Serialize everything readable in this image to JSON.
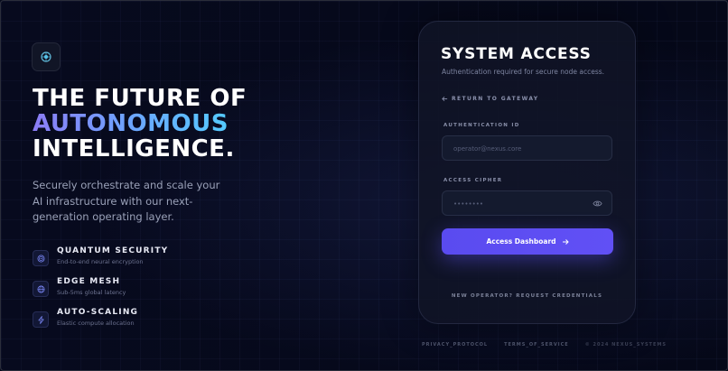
{
  "hero": {
    "line1": "THE FUTURE OF",
    "line2": "AUTONOMOUS",
    "line3": "INTELLIGENCE.",
    "description": "Securely orchestrate and scale your AI infrastructure with our next-generation operating layer."
  },
  "features": [
    {
      "title": "QUANTUM SECURITY",
      "subtitle": "End-to-end neural encryption",
      "icon": "fingerprint-icon"
    },
    {
      "title": "EDGE MESH",
      "subtitle": "Sub-5ms global latency",
      "icon": "globe-icon"
    },
    {
      "title": "AUTO-SCALING",
      "subtitle": "Elastic compute allocation",
      "icon": "lightning-icon"
    }
  ],
  "card": {
    "title": "SYSTEM ACCESS",
    "subtitle": "Authentication required for secure node access.",
    "back_label": "RETURN TO GATEWAY",
    "id_label": "AUTHENTICATION ID",
    "id_placeholder": "operator@nexus.core",
    "cipher_label": "ACCESS CIPHER",
    "cipher_placeholder": "••••••••",
    "submit_label": "Access Dashboard",
    "request_label": "NEW OPERATOR? REQUEST CREDENTIALS"
  },
  "footer": {
    "privacy": "PRIVACY_PROTOCOL",
    "terms": "TERMS_OF_SERVICE",
    "copyright": "© 2024 NEXUS_SYSTEMS"
  },
  "colors": {
    "accent": "#5a4bf0",
    "background": "#06091c",
    "gradient": [
      "#8b7cf6",
      "#4fd1ff"
    ]
  }
}
